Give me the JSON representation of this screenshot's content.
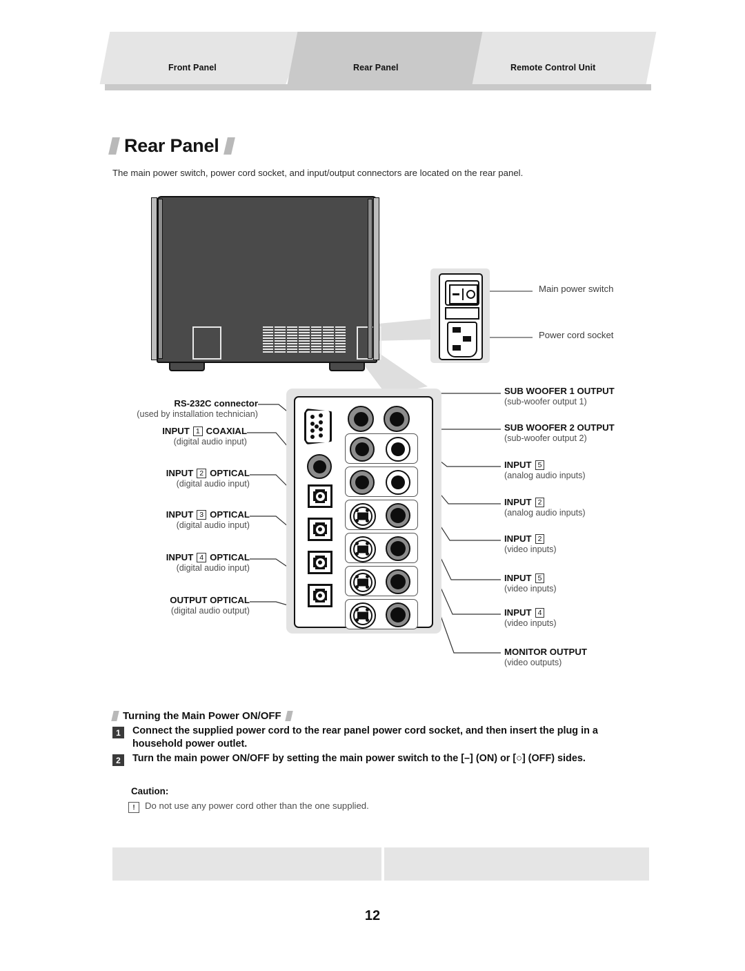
{
  "header": {
    "tabs": [
      {
        "label": "Front Panel",
        "active": false
      },
      {
        "label": "Rear Panel",
        "active": true
      },
      {
        "label": "Remote Control Unit",
        "active": false
      }
    ]
  },
  "title": "Rear Panel",
  "intro": "The main power switch, power cord socket, and input/output connectors are located on the rear panel.",
  "power_detail": {
    "switch_label": "Main power switch",
    "socket_label": "Power cord socket"
  },
  "left_callouts": [
    {
      "bold": "RS-232C connector",
      "sub": "(used by installation technician)"
    },
    {
      "bold_pre": "INPUT",
      "num": "1",
      "bold_post": "COAXIAL",
      "sub": "(digital audio input)"
    },
    {
      "bold_pre": "INPUT",
      "num": "2",
      "bold_post": "OPTICAL",
      "sub": "(digital audio input)"
    },
    {
      "bold_pre": "INPUT",
      "num": "3",
      "bold_post": "OPTICAL",
      "sub": "(digital audio input)"
    },
    {
      "bold_pre": "INPUT",
      "num": "4",
      "bold_post": "OPTICAL",
      "sub": "(digital audio input)"
    },
    {
      "bold": "OUTPUT  OPTICAL",
      "sub": "(digital audio output)"
    }
  ],
  "right_callouts": [
    {
      "bold": "SUB WOOFER 1 OUTPUT",
      "sub": "(sub-woofer output 1)"
    },
    {
      "bold": "SUB WOOFER 2 OUTPUT",
      "sub": "(sub-woofer output 2)"
    },
    {
      "bold_pre": "INPUT",
      "num": "5",
      "sub": "(analog audio inputs)"
    },
    {
      "bold_pre": "INPUT",
      "num": "2",
      "sub": "(analog audio inputs)"
    },
    {
      "bold_pre": "INPUT",
      "num": "2",
      "sub": "(video inputs)"
    },
    {
      "bold_pre": "INPUT",
      "num": "5",
      "sub": "(video inputs)"
    },
    {
      "bold_pre": "INPUT",
      "num": "4",
      "sub": "(video inputs)"
    },
    {
      "bold": "MONITOR OUTPUT",
      "sub": "(video outputs)"
    }
  ],
  "bottom": {
    "heading": "Turning the Main Power ON/OFF",
    "steps": [
      {
        "num": "1",
        "text": "Connect the supplied power cord to the rear panel power cord socket, and then insert the plug in a household power outlet."
      },
      {
        "num": "2",
        "text": "Turn the main power ON/OFF by setting the main power switch to the [–] (ON) or [○] (OFF) sides."
      }
    ],
    "caution_heading": "Caution:",
    "caution_icon": "!",
    "caution_text": "Do not use any power cord other than the one supplied."
  },
  "page_number": "12",
  "colors": {
    "tab_active": "#c9c9c9",
    "tab_inactive": "#e5e5e5",
    "rule": "#c9c9c9",
    "device_body": "#4a4a4a",
    "panel_bg": "#e3e3e3"
  }
}
